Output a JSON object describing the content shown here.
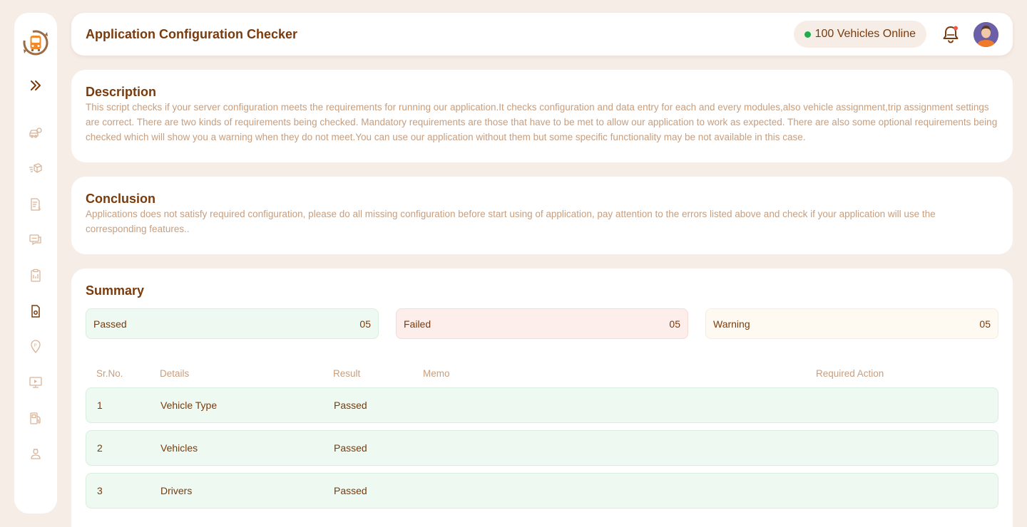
{
  "header": {
    "title": "Application Configuration Checker",
    "online_status": "100 Vehicles Online"
  },
  "sidebar": {
    "items": [
      {
        "icon": "vehicle-settings-icon"
      },
      {
        "icon": "trip-dispatch-icon"
      },
      {
        "icon": "billing-document-icon"
      },
      {
        "icon": "messages-icon"
      },
      {
        "icon": "clipboard-icon"
      },
      {
        "icon": "config-file-icon",
        "active": true
      },
      {
        "icon": "parking-location-icon"
      },
      {
        "icon": "video-monitor-icon"
      },
      {
        "icon": "fuel-station-icon"
      },
      {
        "icon": "driver-icon"
      }
    ]
  },
  "description": {
    "heading": "Description",
    "text": "This script checks if your server configuration meets the requirements for running our application.It checks configuration and data entry for each and every modules,also vehicle assignment,trip assignment settings are correct. There are two kinds of requirements being checked. Mandatory requirements are those that have to be met to allow our application to work as expected. There are also some optional requirements being checked which will show you a warning when they do not meet.You can use our application without them but some specific functionality may be not available in this case."
  },
  "conclusion": {
    "heading": "Conclusion",
    "text": "Applications does not satisfy required configuration, please do all missing configuration before start using of application, pay attention to the errors listed above and check if your application will use the corresponding features.."
  },
  "summary": {
    "heading": "Summary",
    "passed": {
      "label": "Passed",
      "count": "05"
    },
    "failed": {
      "label": "Failed",
      "count": "05"
    },
    "warning": {
      "label": "Warning",
      "count": "05"
    },
    "columns": {
      "sr": "Sr.No.",
      "details": "Details",
      "result": "Result",
      "memo": "Memo",
      "action": "Required Action"
    },
    "rows": [
      {
        "sr": "1",
        "details": "Vehicle Type",
        "result": "Passed",
        "memo": "",
        "action": ""
      },
      {
        "sr": "2",
        "details": "Vehicles",
        "result": "Passed",
        "memo": "",
        "action": ""
      },
      {
        "sr": "3",
        "details": "Drivers",
        "result": "Passed",
        "memo": "",
        "action": ""
      }
    ]
  },
  "colors": {
    "background": "#f6ede7",
    "brand_brown": "#7a3b0c",
    "muted_text": "#c79e7e",
    "passed_bg": "#eef9f1",
    "failed_bg": "#fdeeec",
    "warning_bg": "#fffaf1",
    "online_dot": "#1fae4b",
    "notification_dot": "#ef5a4a",
    "logo_orange": "#f08a2a"
  }
}
